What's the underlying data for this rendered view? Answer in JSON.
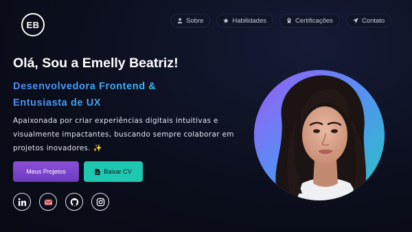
{
  "logo": {
    "initials": "EB"
  },
  "nav": {
    "items": [
      {
        "label": "Sobre",
        "icon": "user-icon"
      },
      {
        "label": "Habilidades",
        "icon": "star-icon"
      },
      {
        "label": "Certificações",
        "icon": "award-icon"
      },
      {
        "label": "Contato",
        "icon": "send-icon"
      }
    ]
  },
  "hero": {
    "title": "Olá, Sou a Emelly Beatriz!",
    "subtitle": "Desenvolvedora Frontend & Entusiasta de UX",
    "description": "Apaixonada por criar experiências digitais intuitivas e visualmente impactantes, buscando sempre colaborar em projetos inovadores. ✨",
    "primary_button": "Meus Projetos",
    "secondary_button": "Baixar CV",
    "secondary_button_icon": "file-icon"
  },
  "socials": [
    {
      "icon": "linkedin-icon"
    },
    {
      "icon": "mail-icon"
    },
    {
      "icon": "github-icon"
    },
    {
      "icon": "instagram-icon"
    }
  ],
  "profile": {
    "photo": "profile-photo"
  },
  "colors": {
    "background": "#0b0e1c",
    "accent_gradient_start": "#4f8df5",
    "accent_gradient_end": "#38c3f0",
    "primary_button": "#7a45cc",
    "secondary_button": "#1ec7b0"
  }
}
